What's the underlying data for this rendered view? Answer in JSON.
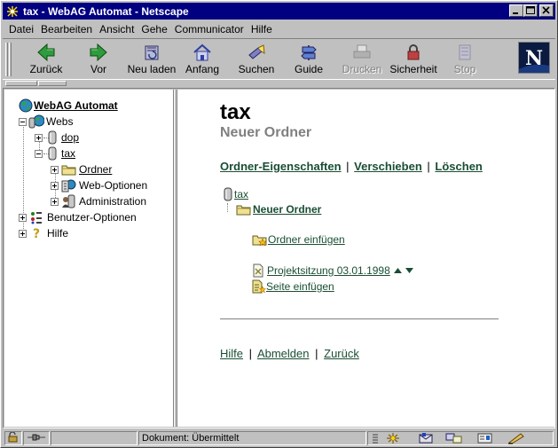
{
  "window": {
    "title": "tax - WebAG Automat - Netscape"
  },
  "menu": [
    "Datei",
    "Bearbeiten",
    "Ansicht",
    "Gehe",
    "Communicator",
    "Hilfe"
  ],
  "toolbar": {
    "back": "Zurück",
    "forward": "Vor",
    "reload": "Neu laden",
    "home": "Anfang",
    "search": "Suchen",
    "guide": "Guide",
    "print": "Drucken",
    "security": "Sicherheit",
    "stop": "Stop"
  },
  "nav_tree": {
    "root": "WebAG Automat",
    "webs": "Webs",
    "dop": "dop",
    "tax": "tax",
    "ordner": "Ordner",
    "web_optionen": "Web-Optionen",
    "administration": "Administration",
    "benutzer_optionen": "Benutzer-Optionen",
    "hilfe": "Hilfe"
  },
  "main": {
    "title": "tax",
    "subtitle": "Neuer Ordner",
    "actions": {
      "properties": "Ordner-Eigenschaften",
      "move": "Verschieben",
      "delete": "Löschen",
      "sep": "|"
    },
    "tree": {
      "root": "tax",
      "folder": "Neuer Ordner",
      "insert_folder": "Ordner einfügen",
      "page": "Projektsitzung 03.01.1998",
      "insert_page": "Seite einfügen"
    },
    "footer": {
      "help": "Hilfe",
      "logout": "Abmelden",
      "back": "Zurück",
      "sep": "|"
    }
  },
  "status": {
    "text": "Dokument: Übermittelt"
  },
  "colors": {
    "titlebar": "#000080",
    "link": "#1a4e34",
    "subtitle": "#808080"
  }
}
